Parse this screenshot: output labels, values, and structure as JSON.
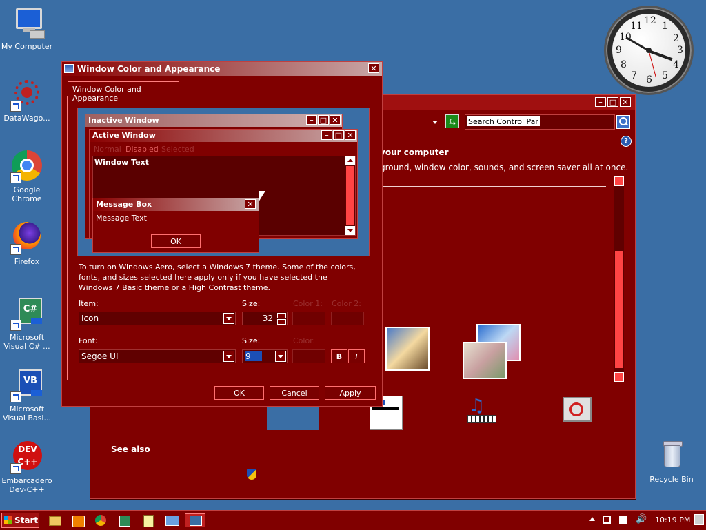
{
  "desktop": {
    "icons": [
      {
        "label": "My Computer",
        "icon": "computer-icon"
      },
      {
        "label": "DataWago...",
        "icon": "datawagon-icon"
      },
      {
        "label": "Google Chrome",
        "icon": "chrome-icon"
      },
      {
        "label": "Firefox",
        "icon": "firefox-icon"
      },
      {
        "label": "Microsoft Visual C# ...",
        "icon": "visual-csharp-icon"
      },
      {
        "label": "Microsoft Visual Basi...",
        "icon": "visual-basic-icon"
      },
      {
        "label": "Embarcadero Dev-C++",
        "icon": "devcpp-icon"
      },
      {
        "label": "Recycle Bin",
        "icon": "recycle-bin-icon"
      }
    ],
    "clock_numbers": [
      "12",
      "1",
      "2",
      "3",
      "4",
      "5",
      "6",
      "7",
      "8",
      "9",
      "10",
      "11"
    ]
  },
  "back_window": {
    "search_placeholder": "Search Control Panel",
    "heading": "your computer",
    "subtext": "ground, window color, sounds, and screen saver all at once.",
    "see_also": "See also"
  },
  "dialog": {
    "title": "Window Color and Appearance",
    "tab": "Window Color and Appearance",
    "preview": {
      "inactive_title": "Inactive Window",
      "active_title": "Active Window",
      "menu_normal": "Normal",
      "menu_disabled": "Disabled",
      "menu_selected": "Selected",
      "window_text": "Window Text",
      "msgbox_title": "Message Box",
      "msgbox_text": "Message Text",
      "msgbox_ok": "OK"
    },
    "info": "To turn on Windows Aero, select a Windows 7 theme.  Some of the colors, fonts, and sizes selected here apply only if you have selected the Windows 7 Basic theme or a High Contrast theme.",
    "item_label": "Item:",
    "item_value": "Icon",
    "size_label": "Size:",
    "size_value": "32",
    "color1_label": "Color 1:",
    "color2_label": "Color 2:",
    "font_label": "Font:",
    "font_value": "Segoe UI",
    "font_size_label": "Size:",
    "font_size_value": "9",
    "font_color_label": "Color:",
    "bold_label": "B",
    "italic_label": "I",
    "ok": "OK",
    "cancel": "Cancel",
    "apply": "Apply"
  },
  "taskbar": {
    "start": "Start",
    "time": "10:19 PM",
    "items": [
      "explorer-icon",
      "media-player-icon",
      "chrome-icon",
      "visual-csharp-icon",
      "notepad-icon",
      "network-icon",
      "personalize-icon"
    ]
  },
  "colors": {
    "frame": "#800000",
    "desktop": "#3a6ea5",
    "accent": "#ff4444"
  }
}
